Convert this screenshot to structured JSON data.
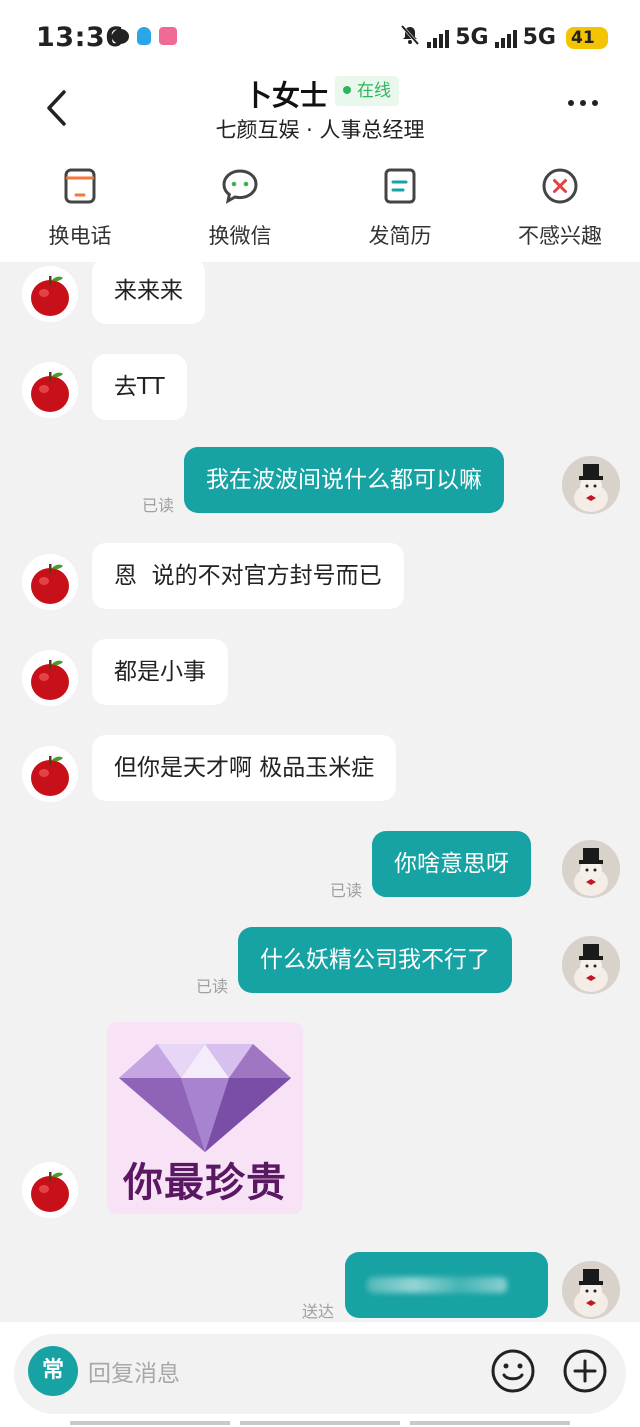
{
  "status_bar": {
    "time": "13:36",
    "network_1": "5G",
    "network_2": "5G",
    "battery": "41"
  },
  "header": {
    "contact_name": "卜女士",
    "online_status": "在线",
    "subtitle": "七颜互娱 · 人事总经理"
  },
  "actions": [
    {
      "label": "换电话",
      "icon": "phone-icon",
      "color": "#f07a3a"
    },
    {
      "label": "换微信",
      "icon": "wechat-icon",
      "color": "#3bb34a"
    },
    {
      "label": "发简历",
      "icon": "resume-icon",
      "color": "#17a2a3"
    },
    {
      "label": "不感兴趣",
      "icon": "close-circle-icon",
      "color": "#e34040"
    }
  ],
  "messages": [
    {
      "side": "in",
      "text": "来来来"
    },
    {
      "side": "in",
      "text": "去TT"
    },
    {
      "side": "out",
      "text": "我在波波间说什么都可以嘛",
      "status": "已读"
    },
    {
      "side": "in",
      "text": "恩  说的不对官方封号而已"
    },
    {
      "side": "in",
      "text": "都是小事"
    },
    {
      "side": "in",
      "text": "但你是天才啊 极品玉米症"
    },
    {
      "side": "out",
      "text": "你啥意思呀",
      "status": "已读"
    },
    {
      "side": "out",
      "text": "什么妖精公司我不行了",
      "status": "已读"
    },
    {
      "side": "in",
      "type": "sticker",
      "text": "你最珍贵",
      "icon": "diamond-icon"
    },
    {
      "side": "out",
      "text": "",
      "status": "送达"
    }
  ],
  "input": {
    "common_label": "常",
    "placeholder": "回复消息"
  },
  "colors": {
    "accent": "#17a2a3",
    "online": "#2db55d",
    "battery": "#f5c400"
  }
}
